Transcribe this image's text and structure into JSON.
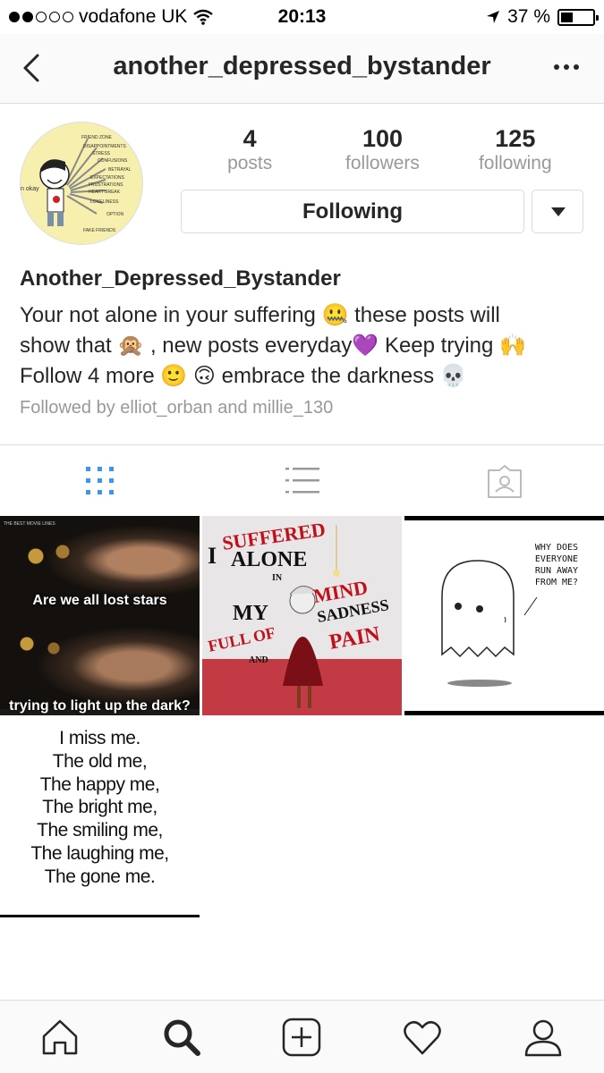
{
  "status_bar": {
    "carrier": "vodafone UK",
    "time": "20:13",
    "battery": "37 %",
    "battery_level": 0.37
  },
  "header": {
    "username": "another_depressed_bystander"
  },
  "profile": {
    "stats": [
      {
        "count": "4",
        "label": "posts"
      },
      {
        "count": "100",
        "label": "followers"
      },
      {
        "count": "125",
        "label": "following"
      }
    ],
    "follow_button": "Following",
    "name": "Another_Depressed_Bystander",
    "bio_lines": [
      "Your not alone in your suffering 🤐 these posts will",
      "show that 🙊 , new posts everyday💜 Keep trying 🙌",
      "Follow 4 more 🙂 🙃 embrace the darkness 💀"
    ],
    "followed_by": "Followed by elliot_orban and millie_130",
    "avatar_words": [
      "n okay",
      "FRIEND ZONE",
      "DISAPPOINTMENTS",
      "STRESS",
      "CONFUSIONS",
      "BETRAYAL",
      "EXPECTATIONS",
      "FRUSTRATIONS",
      "HEART BREAK",
      "LONELINESS",
      "OPTION",
      "FAKE FRIENDS"
    ]
  },
  "tabs": [
    {
      "icon": "grid-icon",
      "active": true
    },
    {
      "icon": "list-icon",
      "active": false
    },
    {
      "icon": "tagged-icon",
      "active": false
    }
  ],
  "posts": {
    "post1": {
      "line1": "Are we all lost stars",
      "line2": "trying to light up the dark?",
      "watermark": "THE BEST MOVIE LINES"
    },
    "post2": {
      "words": [
        "I",
        "SUFFERED",
        "ALONE",
        "IN",
        "MY",
        "MIND",
        "SADNESS",
        "FULL OF",
        "AND",
        "PAIN"
      ]
    },
    "post3": {
      "bubble": [
        "WHY DOES",
        "EVERYONE",
        "RUN AWAY",
        "FROM ME?"
      ]
    },
    "post4": {
      "lines": [
        "I miss me.",
        "The old me,",
        "The happy me,",
        "The bright me,",
        "The smiling me,",
        "The laughing me,",
        "The gone me."
      ]
    }
  },
  "bottom_nav": [
    "home-icon",
    "search-icon",
    "add-icon",
    "heart-icon",
    "profile-icon"
  ],
  "colors": {
    "accent": "#3897f0",
    "text": "#262626",
    "muted": "#999999",
    "border": "#dbdbdb"
  }
}
